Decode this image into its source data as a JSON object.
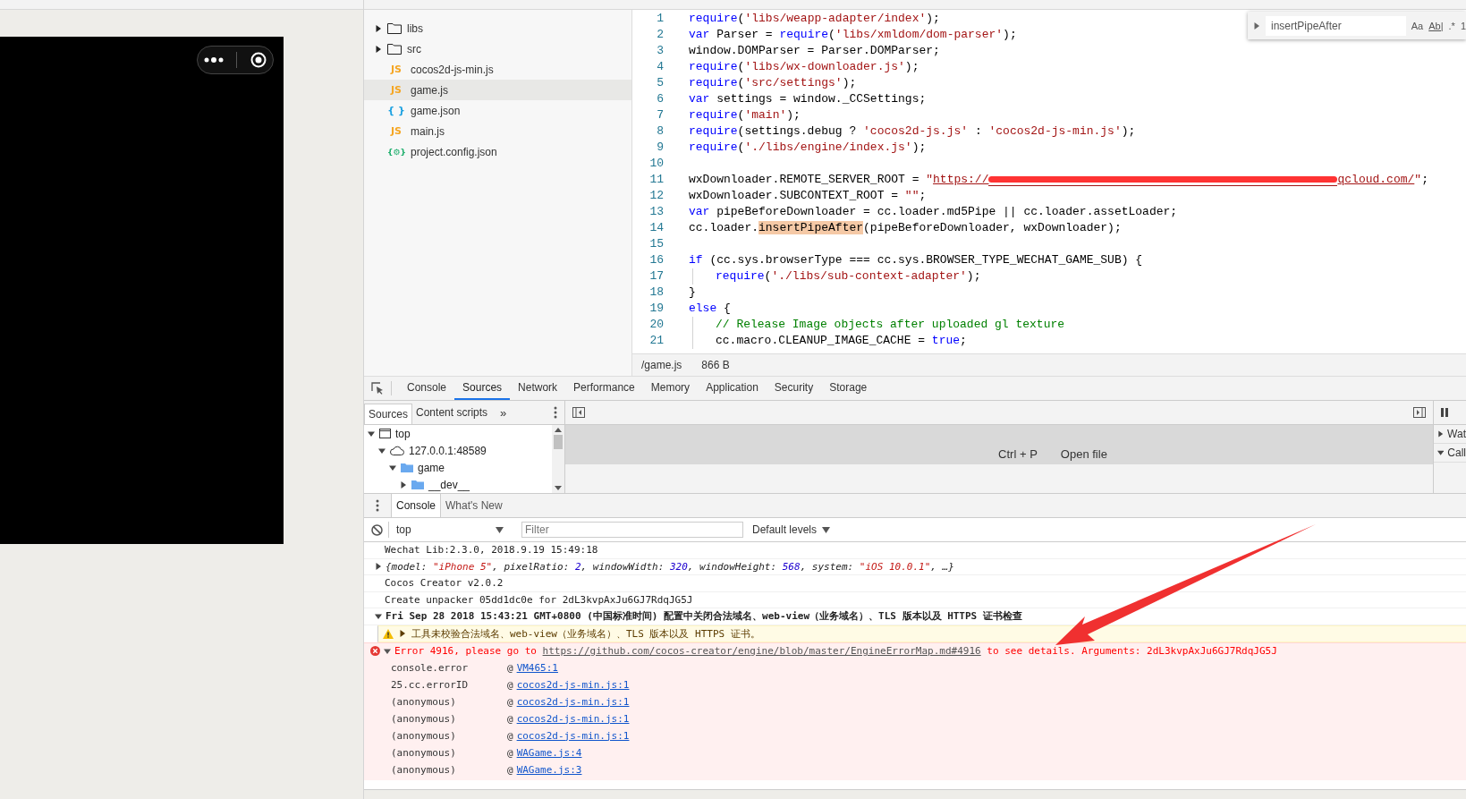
{
  "file_tree": {
    "items": [
      {
        "kind": "folder",
        "name": "libs",
        "expanded": false,
        "selected": false
      },
      {
        "kind": "folder",
        "name": "src",
        "expanded": false,
        "selected": false
      },
      {
        "kind": "js",
        "icon": "JS",
        "name": "cocos2d-js-min.js",
        "selected": false
      },
      {
        "kind": "js",
        "icon": "JS",
        "name": "game.js",
        "selected": true
      },
      {
        "kind": "json",
        "icon": "{ }",
        "name": "game.json",
        "selected": false
      },
      {
        "kind": "js",
        "icon": "JS",
        "name": "main.js",
        "selected": false
      },
      {
        "kind": "config",
        "icon": "{⚙}",
        "name": "project.config.json",
        "selected": false
      }
    ]
  },
  "editor": {
    "lines": [
      {
        "number": "1",
        "segments": [
          {
            "kind": "kw",
            "text": "require"
          },
          {
            "kind": "plain",
            "text": "("
          },
          {
            "kind": "str",
            "text": "'libs/weapp-adapter/index'"
          },
          {
            "kind": "plain",
            "text": ");"
          }
        ]
      },
      {
        "number": "2",
        "segments": [
          {
            "kind": "kw",
            "text": "var"
          },
          {
            "kind": "plain",
            "text": " Parser = "
          },
          {
            "kind": "kw",
            "text": "require"
          },
          {
            "kind": "plain",
            "text": "("
          },
          {
            "kind": "str",
            "text": "'libs/xmldom/dom-parser'"
          },
          {
            "kind": "plain",
            "text": ");"
          }
        ]
      },
      {
        "number": "3",
        "segments": [
          {
            "kind": "plain",
            "text": "window.DOMParser = Parser.DOMParser;"
          }
        ]
      },
      {
        "number": "4",
        "segments": [
          {
            "kind": "kw",
            "text": "require"
          },
          {
            "kind": "plain",
            "text": "("
          },
          {
            "kind": "str",
            "text": "'libs/wx-downloader.js'"
          },
          {
            "kind": "plain",
            "text": ");"
          }
        ]
      },
      {
        "number": "5",
        "segments": [
          {
            "kind": "kw",
            "text": "require"
          },
          {
            "kind": "plain",
            "text": "("
          },
          {
            "kind": "str",
            "text": "'src/settings'"
          },
          {
            "kind": "plain",
            "text": ");"
          }
        ]
      },
      {
        "number": "6",
        "segments": [
          {
            "kind": "kw",
            "text": "var"
          },
          {
            "kind": "plain",
            "text": " settings = window._CCSettings;"
          }
        ]
      },
      {
        "number": "7",
        "segments": [
          {
            "kind": "kw",
            "text": "require"
          },
          {
            "kind": "plain",
            "text": "("
          },
          {
            "kind": "str",
            "text": "'main'"
          },
          {
            "kind": "plain",
            "text": ");"
          }
        ]
      },
      {
        "number": "8",
        "segments": [
          {
            "kind": "kw",
            "text": "require"
          },
          {
            "kind": "plain",
            "text": "(settings.debug ? "
          },
          {
            "kind": "str",
            "text": "'cocos2d-js.js'"
          },
          {
            "kind": "plain",
            "text": " : "
          },
          {
            "kind": "str",
            "text": "'cocos2d-js-min.js'"
          },
          {
            "kind": "plain",
            "text": ");"
          }
        ]
      },
      {
        "number": "9",
        "segments": [
          {
            "kind": "kw",
            "text": "require"
          },
          {
            "kind": "plain",
            "text": "("
          },
          {
            "kind": "str",
            "text": "'./libs/engine/index.js'"
          },
          {
            "kind": "plain",
            "text": ");"
          }
        ]
      },
      {
        "number": "10"
      },
      {
        "number": "11",
        "segments": [
          {
            "kind": "plain",
            "text": "wxDownloader.REMOTE_SERVER_ROOT = "
          },
          {
            "kind": "str",
            "text": "\""
          },
          {
            "kind": "url",
            "text": "https://"
          },
          {
            "kind": "redact"
          },
          {
            "kind": "url",
            "text": "qcloud.com/"
          },
          {
            "kind": "str",
            "text": "\""
          },
          {
            "kind": "plain",
            "text": ";"
          }
        ]
      },
      {
        "number": "12",
        "segments": [
          {
            "kind": "plain",
            "text": "wxDownloader.SUBCONTEXT_ROOT = "
          },
          {
            "kind": "str",
            "text": "\"\""
          },
          {
            "kind": "plain",
            "text": ";"
          }
        ]
      },
      {
        "number": "13",
        "segments": [
          {
            "kind": "kw",
            "text": "var"
          },
          {
            "kind": "plain",
            "text": " pipeBeforeDownloader = cc.loader.md5Pipe || cc.loader.assetLoader;"
          }
        ]
      },
      {
        "number": "14",
        "segments": [
          {
            "kind": "plain",
            "text": "cc.loader."
          },
          {
            "kind": "hl",
            "text": "insertPipeAfter"
          },
          {
            "kind": "plain",
            "text": "(pipeBeforeDownloader, wxDownloader);"
          }
        ]
      },
      {
        "number": "15"
      },
      {
        "number": "16",
        "segments": [
          {
            "kind": "kw",
            "text": "if"
          },
          {
            "kind": "plain",
            "text": " (cc.sys.browserType === cc.sys.BROWSER_TYPE_WECHAT_GAME_SUB) {"
          }
        ]
      },
      {
        "number": "17",
        "indented": true,
        "segments": [
          {
            "kind": "kw",
            "text": "require"
          },
          {
            "kind": "plain",
            "text": "("
          },
          {
            "kind": "str",
            "text": "'./libs/sub-context-adapter'"
          },
          {
            "kind": "plain",
            "text": ");"
          }
        ]
      },
      {
        "number": "18",
        "segments": [
          {
            "kind": "plain",
            "text": "}"
          }
        ]
      },
      {
        "number": "19",
        "segments": [
          {
            "kind": "kw",
            "text": "else"
          },
          {
            "kind": "plain",
            "text": " {"
          }
        ]
      },
      {
        "number": "20",
        "indented": true,
        "segments": [
          {
            "kind": "com",
            "text": "// Release Image objects after uploaded gl texture"
          }
        ]
      },
      {
        "number": "21",
        "indented": true,
        "segments": [
          {
            "kind": "plain",
            "text": "cc.macro.CLEANUP_IMAGE_CACHE = "
          },
          {
            "kind": "kw",
            "text": "true"
          },
          {
            "kind": "plain",
            "text": ";"
          }
        ]
      }
    ],
    "find": {
      "value": "insertPipeAfter",
      "case_label": "Aa",
      "word_label": "Ab|",
      "regex_label": ".*",
      "count": "1"
    },
    "status": {
      "file": "/game.js",
      "size": "866 B"
    }
  },
  "devtools": {
    "tabs": [
      {
        "label": "Console",
        "selected": false
      },
      {
        "label": "Sources",
        "selected": true
      },
      {
        "label": "Network",
        "selected": false
      },
      {
        "label": "Performance",
        "selected": false
      },
      {
        "label": "Memory",
        "selected": false
      },
      {
        "label": "Application",
        "selected": false
      },
      {
        "label": "Security",
        "selected": false
      },
      {
        "label": "Storage",
        "selected": false
      }
    ],
    "sources": {
      "nav_tabs": [
        {
          "label": "Sources",
          "selected": true
        },
        {
          "label": "Content scripts",
          "selected": false
        }
      ],
      "more": "»",
      "tree": [
        {
          "kind": "frame",
          "label": "top",
          "expanded": true,
          "children": [
            {
              "kind": "origin",
              "label": "127.0.0.1:48589",
              "expanded": true,
              "children": [
                {
                  "kind": "folder",
                  "label": "game",
                  "expanded": true,
                  "children": [
                    {
                      "kind": "folder",
                      "label": "__dev__",
                      "expanded": false
                    }
                  ]
                }
              ]
            }
          ]
        }
      ],
      "shortcut": "Ctrl + P",
      "shortcut_action": "Open file",
      "side_sections": [
        {
          "label": "Wat",
          "expanded": false
        },
        {
          "label": "Call",
          "expanded": true
        }
      ]
    },
    "drawer": {
      "tabs": [
        {
          "label": "Console",
          "selected": true
        },
        {
          "label": "What's New",
          "selected": false
        }
      ],
      "context": "top",
      "filter_placeholder": "Filter",
      "levels": "Default levels",
      "messages": [
        {
          "kind": "log",
          "text": "Wechat Lib:2.3.0, 2018.9.19 15:49:18"
        },
        {
          "kind": "object",
          "expanded": false,
          "segments": [
            {
              "kind": "plain",
              "text": "{model: "
            },
            {
              "kind": "str",
              "text": "\"iPhone 5\""
            },
            {
              "kind": "plain",
              "text": ", pixelRatio: "
            },
            {
              "kind": "num",
              "text": "2"
            },
            {
              "kind": "plain",
              "text": ", windowWidth: "
            },
            {
              "kind": "num",
              "text": "320"
            },
            {
              "kind": "plain",
              "text": ", windowHeight: "
            },
            {
              "kind": "num",
              "text": "568"
            },
            {
              "kind": "plain",
              "text": ", system: "
            },
            {
              "kind": "str",
              "text": "\"iOS 10.0.1\""
            },
            {
              "kind": "plain",
              "text": ", …}"
            }
          ]
        },
        {
          "kind": "log",
          "text": "Cocos Creator v2.0.2"
        },
        {
          "kind": "log",
          "text": "Create unpacker 05dd1dc0e for 2dL3kvpAxJu6GJ7RdqJG5J"
        },
        {
          "kind": "group",
          "expanded": true,
          "text": "Fri Sep 28 2018 15:43:21 GMT+0800 (中国标准时间) 配置中关闭合法域名、web-view（业务域名）、TLS 版本以及 HTTPS 证书检查",
          "children": [
            {
              "kind": "warning",
              "expanded": false,
              "text": "工具未校验合法域名、web-view（业务域名）、TLS 版本以及 HTTPS 证书。"
            }
          ]
        },
        {
          "kind": "error",
          "expanded": true,
          "segments": [
            {
              "kind": "text",
              "text": "Error 4916, please go to "
            },
            {
              "kind": "link",
              "text": "https://github.com/cocos-creator/engine/blob/master/EngineErrorMap.md#4916"
            },
            {
              "kind": "text",
              "text": " to see details. Arguments: 2dL3kvpAxJu6GJ7RdqJG5J"
            }
          ],
          "stack": [
            {
              "function": "console.error",
              "at": "@",
              "source": "VM465:1"
            },
            {
              "function": "25.cc.errorID",
              "at": "@",
              "source": "cocos2d-js-min.js:1"
            },
            {
              "function": "(anonymous)",
              "at": "@",
              "source": "cocos2d-js-min.js:1"
            },
            {
              "function": "(anonymous)",
              "at": "@",
              "source": "cocos2d-js-min.js:1"
            },
            {
              "function": "(anonymous)",
              "at": "@",
              "source": "cocos2d-js-min.js:1"
            },
            {
              "function": "(anonymous)",
              "at": "@",
              "source": "WAGame.js:4"
            },
            {
              "function": "(anonymous)",
              "at": "@",
              "source": "WAGame.js:3"
            }
          ]
        }
      ]
    }
  }
}
